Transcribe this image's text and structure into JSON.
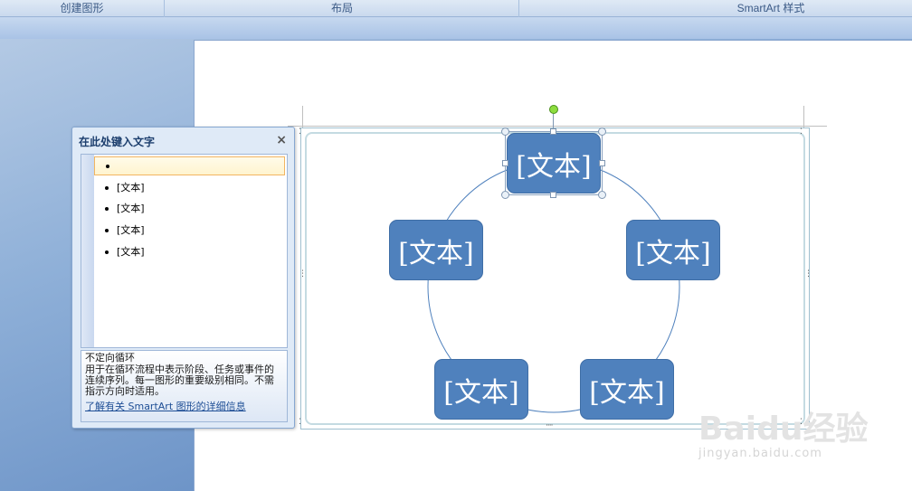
{
  "ribbon": {
    "groups": [
      "创建图形",
      "布局",
      "SmartArt 样式"
    ]
  },
  "text_pane": {
    "title": "在此处键入文字",
    "close_icon": "×",
    "items": [
      "",
      "[文本]",
      "[文本]",
      "[文本]",
      "[文本]"
    ],
    "description_title": "不定向循环",
    "description_body": "用于在循环流程中表示阶段、任务或事件的连续序列。每一图形的重要级别相同。不需指示方向时适用。",
    "help_link": "了解有关 SmartArt 图形的详细信息"
  },
  "diagram": {
    "layout": "不定向循环",
    "nodes": [
      "[文本]",
      "[文本]",
      "[文本]",
      "[文本]",
      "[文本]"
    ],
    "node_color": "#4f81bd",
    "connector_color": "#4f81bd"
  },
  "watermark": {
    "main": "Baidu经验",
    "sub": "jingyan.baidu.com"
  }
}
